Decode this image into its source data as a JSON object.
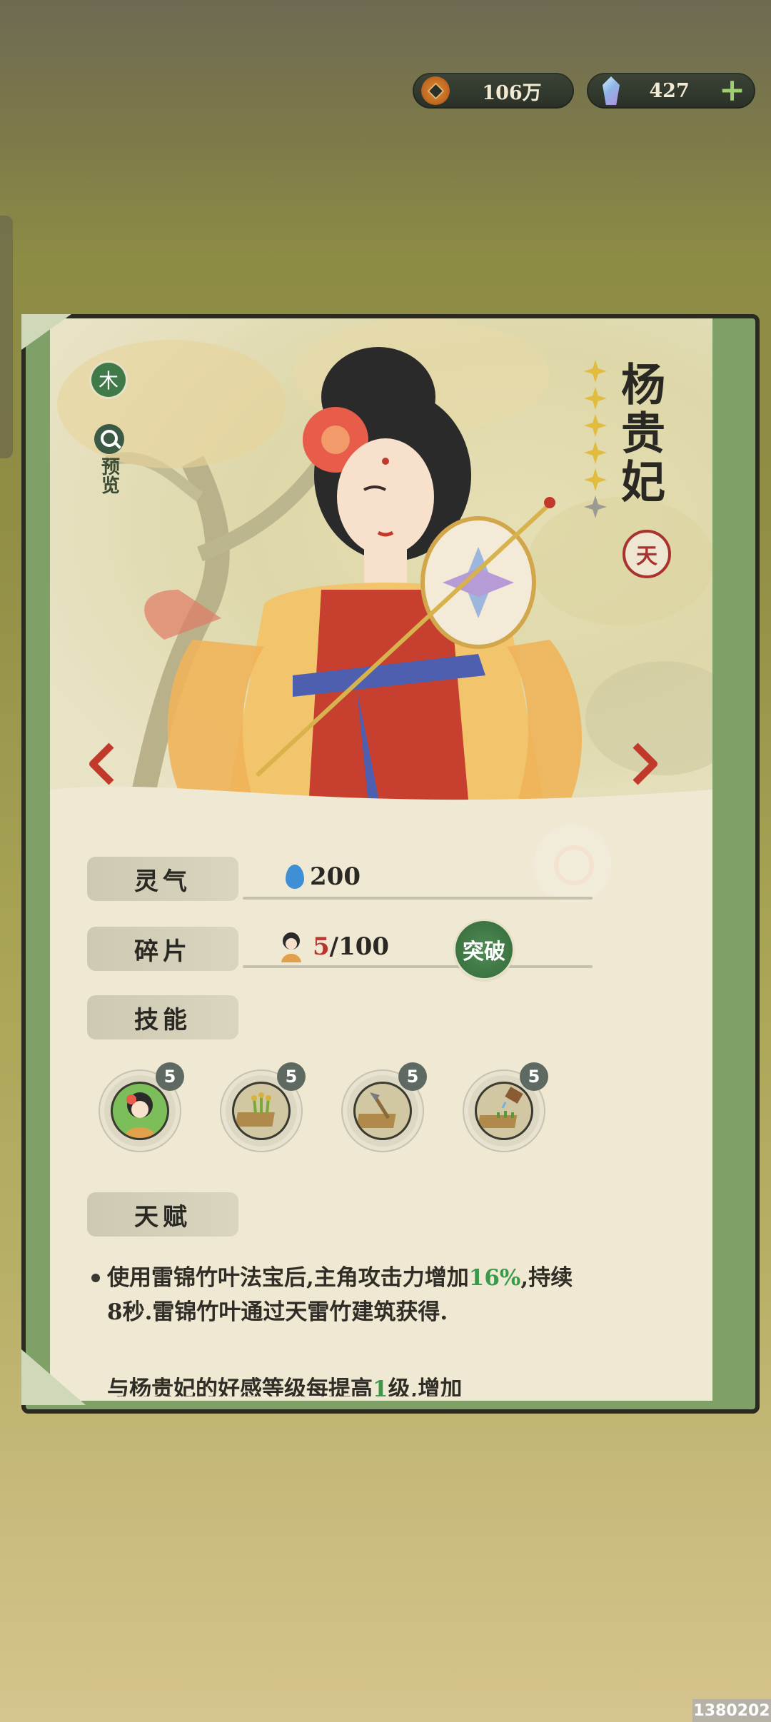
{
  "currency": {
    "coins": "106万",
    "gems": "427",
    "add_label": "+"
  },
  "character": {
    "name": "杨贵妃",
    "element": "木",
    "preview_label": "预览",
    "rank": "天",
    "stars_filled": 5,
    "stars_total": 6
  },
  "stats": {
    "spirit_label": "灵气",
    "spirit_value": "200",
    "fragments_label": "碎片",
    "fragments_current": "5",
    "fragments_total": "/100",
    "breakthrough_label": "突破",
    "skills_label": "技能",
    "talent_label": "天赋"
  },
  "skills": [
    {
      "name": "portrait-skill",
      "level": "5"
    },
    {
      "name": "crop-skill",
      "level": "5"
    },
    {
      "name": "hoe-skill",
      "level": "5"
    },
    {
      "name": "watering-skill",
      "level": "5"
    }
  ],
  "talent": {
    "line1_a": "使用雷锦竹叶法宝后,主角攻击力增加",
    "line1_highlight": "16%",
    "line1_b": ",持续8秒.雷锦竹叶通过天雷竹建筑获得.",
    "line2_a": "与杨贵妃的好感等级每提高",
    "line2_highlight": "1",
    "line2_b": "级,增加"
  },
  "watermark": "1380202",
  "colors": {
    "accent_green": "#3a9a4a",
    "accent_red": "#b8352d",
    "scroll_green": "#7fa067"
  }
}
